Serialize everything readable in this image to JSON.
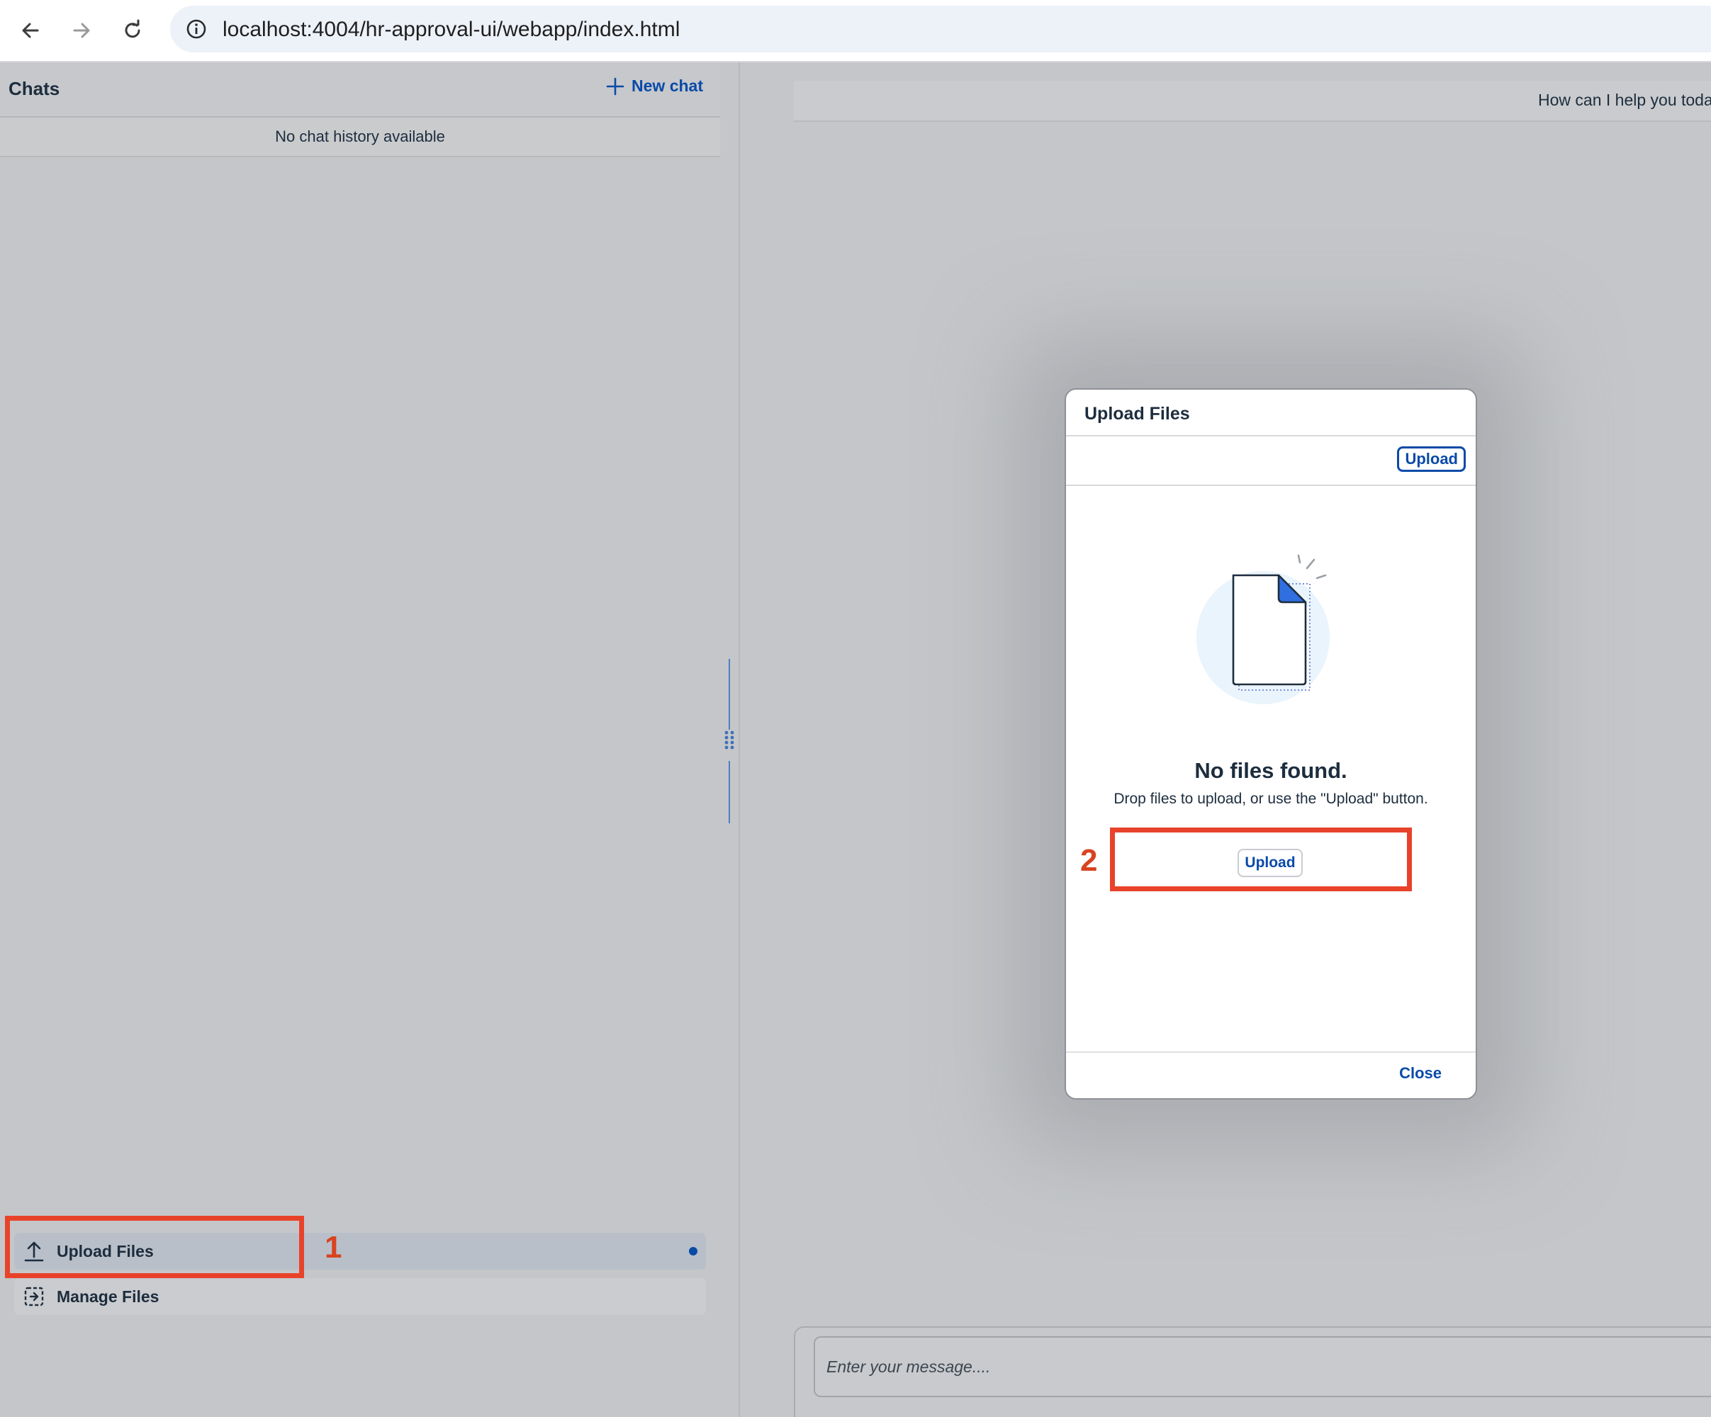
{
  "browser": {
    "url": "localhost:4004/hr-approval-ui/webapp/index.html",
    "back_icon": "arrow-left-icon",
    "forward_icon": "arrow-right-icon",
    "reload_icon": "reload-icon",
    "info_icon": "info-icon"
  },
  "sidebar": {
    "title": "Chats",
    "new_chat_label": "New chat",
    "empty_history": "No chat history available",
    "items": [
      {
        "label": "Upload Files",
        "icon": "upload-icon"
      },
      {
        "label": "Manage Files",
        "icon": "manage-files-icon"
      }
    ]
  },
  "chat": {
    "greeting": "How can I help you today?",
    "input_placeholder": "Enter your message...."
  },
  "dialog": {
    "title": "Upload Files",
    "toolbar_upload_label": "Upload",
    "empty_title": "No files found.",
    "empty_subtitle": "Drop files to upload, or use the \"Upload\" button.",
    "center_upload_label": "Upload",
    "close_label": "Close"
  },
  "annotations": {
    "step1": "1",
    "step2": "2"
  },
  "colors": {
    "accent": "#0a4aa8",
    "annotation": "#e8432a",
    "overlay": "#c4c6c9"
  }
}
